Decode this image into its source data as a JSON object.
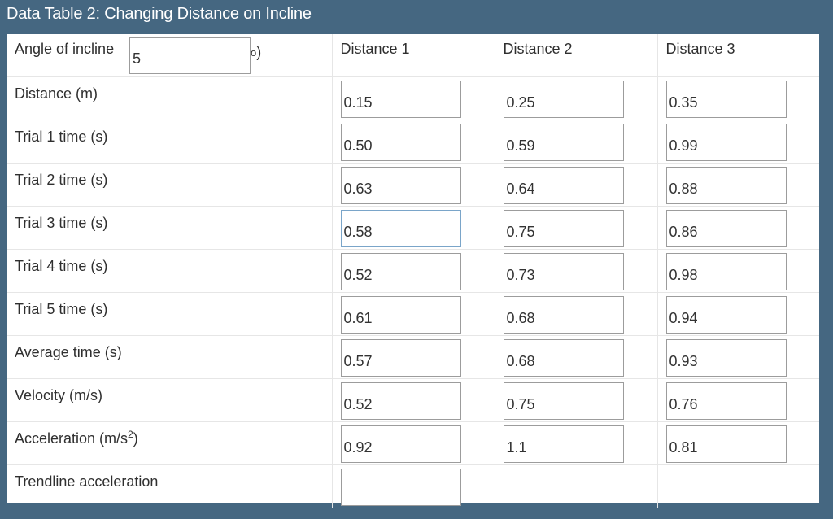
{
  "title": "Data Table 2: Changing Distance on Incline",
  "header": {
    "angle_label": "Angle of incline",
    "angle_value": "5",
    "degree_symbol": "o",
    "close_paren": ")",
    "columns": [
      "Distance 1",
      "Distance 2",
      "Distance 3"
    ]
  },
  "rows": [
    {
      "label": "Distance (m)",
      "values": [
        "0.15",
        "0.25",
        "0.35"
      ]
    },
    {
      "label": "Trial 1 time (s)",
      "values": [
        "0.50",
        "0.59",
        "0.99"
      ]
    },
    {
      "label": "Trial 2 time (s)",
      "values": [
        "0.63",
        "0.64",
        "0.88"
      ]
    },
    {
      "label": "Trial 3 time (s)",
      "values": [
        "0.58",
        "0.75",
        "0.86"
      ]
    },
    {
      "label": "Trial 4 time (s)",
      "values": [
        "0.52",
        "0.73",
        "0.98"
      ]
    },
    {
      "label": "Trial 5 time (s)",
      "values": [
        "0.61",
        "0.68",
        "0.94"
      ]
    },
    {
      "label": "Average time (s)",
      "values": [
        "0.57",
        "0.68",
        "0.93"
      ]
    },
    {
      "label": "Velocity (m/s)",
      "values": [
        "0.52",
        "0.75",
        "0.76"
      ]
    },
    {
      "label_main": "Acceleration (m/s",
      "label_sup": "2",
      "label_end": ")",
      "values": [
        "0.92",
        "1.1",
        "0.81"
      ]
    },
    {
      "label": "Trendline acceleration",
      "values": [
        ""
      ]
    }
  ],
  "colors": {
    "background": "#456781",
    "panel": "#ffffff",
    "focused_border": "#7aa5c9"
  }
}
